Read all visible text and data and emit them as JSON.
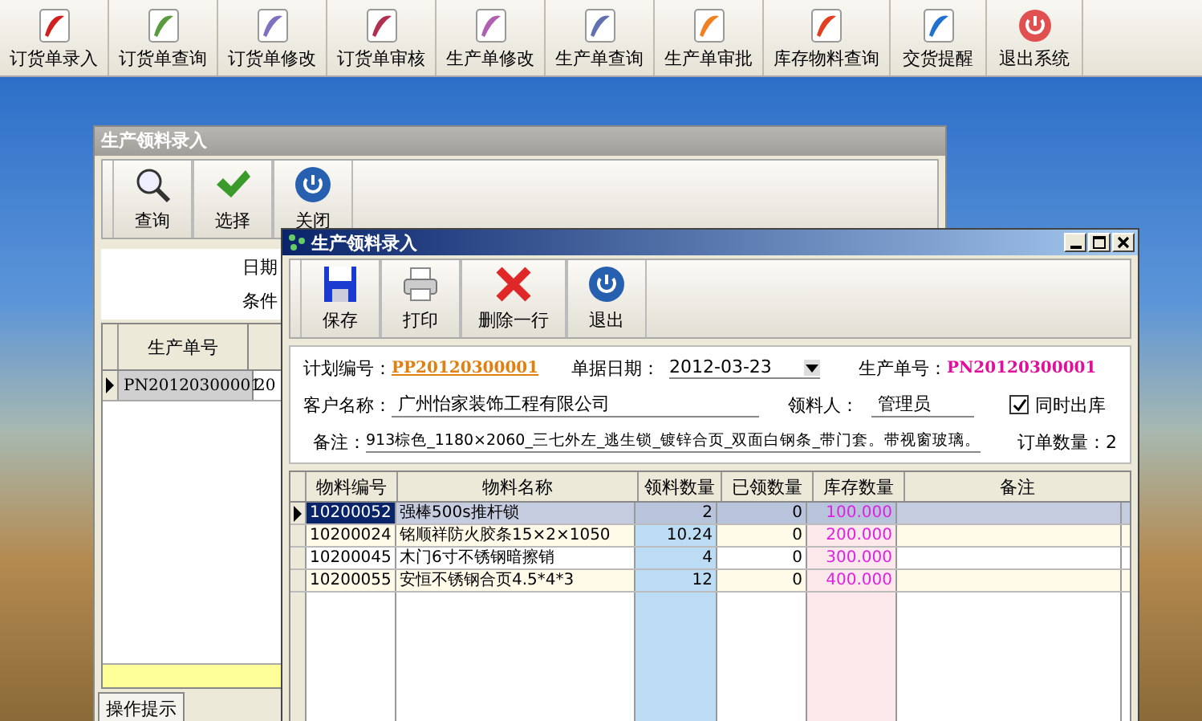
{
  "toolbar": [
    {
      "label": "订货单录入"
    },
    {
      "label": "订货单查询"
    },
    {
      "label": "订货单修改"
    },
    {
      "label": "订货单审核"
    },
    {
      "label": "生产单修改"
    },
    {
      "label": "生产单查询"
    },
    {
      "label": "生产单审批"
    },
    {
      "label": "库存物料查询"
    },
    {
      "label": "交货提醒"
    },
    {
      "label": "退出系统"
    }
  ],
  "back_window": {
    "title": "生产领料录入",
    "buttons": [
      {
        "label": "查询"
      },
      {
        "label": "选择"
      },
      {
        "label": "关闭"
      }
    ],
    "filter_labels": [
      "日期",
      "条件"
    ],
    "table": {
      "columns": [
        "生产单号"
      ],
      "rows": [
        {
          "cells": [
            "PN20120300001",
            "20"
          ],
          "selected": true
        }
      ]
    },
    "tab": "操作提示"
  },
  "dialog": {
    "title": "生产领料录入",
    "buttons": [
      {
        "label": "保存"
      },
      {
        "label": "打印"
      },
      {
        "label": "删除一行"
      },
      {
        "label": "退出"
      }
    ],
    "form": {
      "plan_no_label": "计划编号：",
      "plan_no": "PP20120300001",
      "date_label": "单据日期：",
      "date": "2012-03-23",
      "production_no_label": "生产单号：",
      "production_no": "PN20120300001",
      "customer_label": "客户名称：",
      "customer": "广州怡家装饰工程有限公司",
      "receiver_label": "领料人：",
      "receiver": "管理员",
      "same_time_out": {
        "label": "同时出库",
        "checked": true
      },
      "memo_label": "备注：",
      "memo": "913棕色_1180×2060_三七外左_逃生锁_镀锌合页_双面白钢条_带门套。带视窗玻璃。",
      "order_qty": "订单数量：2"
    },
    "table": {
      "columns": [
        "物料编号",
        "物料名称",
        "领料数量",
        "已领数量",
        "库存数量",
        "备注"
      ],
      "rows": [
        {
          "cells": [
            "10200052",
            "强棒500s推杆锁",
            "2",
            "0",
            "100.000"
          ],
          "selected": true
        },
        {
          "cells": [
            "10200024",
            "铭顺祥防火胶条15×2×1050",
            "10.24",
            "0",
            "200.000"
          ],
          "selected": false
        },
        {
          "cells": [
            "10200045",
            "木门6寸不锈钢暗擦销",
            "4",
            "0",
            "300.000"
          ],
          "selected": false
        },
        {
          "cells": [
            "10200055",
            "安恒不锈钢合页4.5*4*3",
            "12",
            "0",
            "400.000"
          ],
          "selected": false
        }
      ]
    }
  }
}
